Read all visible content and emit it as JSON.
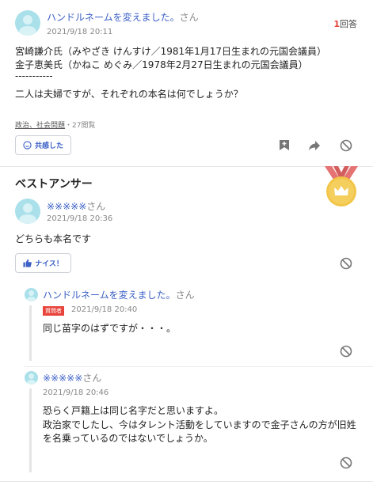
{
  "question": {
    "author": "ハンドルネームを変えました。",
    "honorific": "さん",
    "date": "2021/9/18 20:11",
    "answer_count": "1",
    "answer_label": "回答",
    "line1": "宮崎謙介氏（みやざき けんすけ／1981年1月17日生まれの元国会議員）",
    "line2": "金子恵美氏（かねこ めぐみ／1978年2月27日生まれの元国会議員）",
    "separator": "-----------",
    "body": "二人は夫婦ですが、それぞれの本名は何でしょうか？",
    "category": "政治、社会問題",
    "views": "・27閲覧",
    "empathy_label": "共感した"
  },
  "best_answer": {
    "heading": "ベストアンサー",
    "author": "※※※※※",
    "honorific": "さん",
    "date": "2021/9/18 20:36",
    "body": "どちらも本名です",
    "nice_label": "ナイス！"
  },
  "replies": [
    {
      "author": "ハンドルネームを変えました。",
      "honorific": "さん",
      "badge": "質問者",
      "date": "2021/9/18 20:40",
      "body": "同じ苗字のはずですが・・・。"
    },
    {
      "author": "※※※※※",
      "honorific": "さん",
      "date": "2021/9/18 20:46",
      "line1": "恐らく戸籍上は同じ名字だと思いますよ。",
      "line2": "政治家でしたし、今はタレント活動をしていますので金子さんの方が旧姓",
      "line3": "を名乗っているのではないでしょうか。"
    }
  ],
  "colors": {
    "link": "#3b60c6",
    "accent_red": "#e8443b",
    "medal_gold": "#f2c548",
    "ribbon": "#e57373"
  },
  "icons": [
    "user-avatar-icon",
    "smile-icon",
    "bookmark-add-icon",
    "share-arrow-icon",
    "block-icon",
    "thumbs-up-icon",
    "crown-medal-icon"
  ]
}
